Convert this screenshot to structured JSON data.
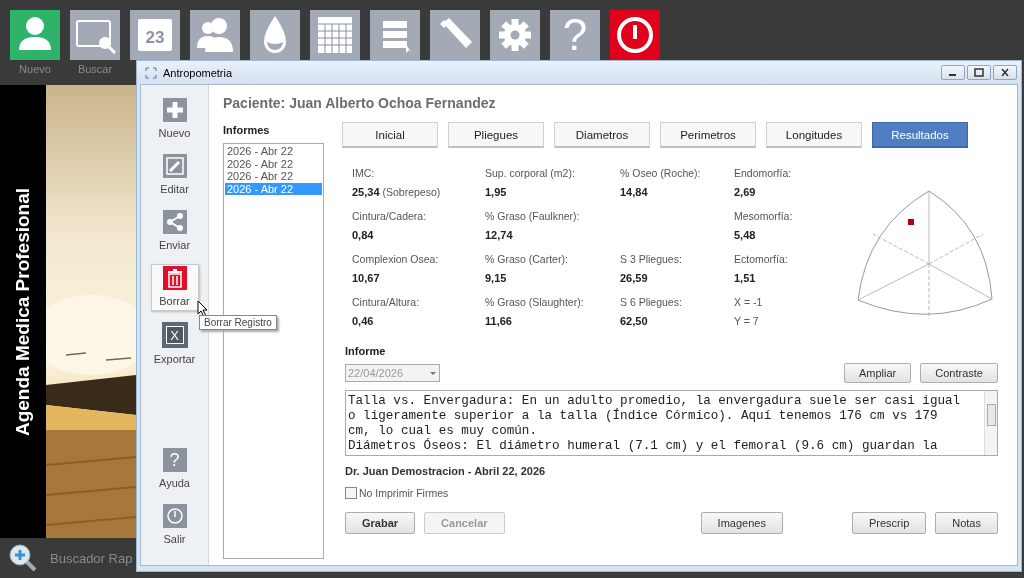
{
  "toolbar": [
    {
      "kind": "person",
      "label": "Nuevo",
      "color": "#2fb36b"
    },
    {
      "kind": "screen-search",
      "label": "Buscar",
      "color": "#a3aab5"
    },
    {
      "kind": "calendar",
      "badge": "23",
      "color": "#a3aab5"
    },
    {
      "kind": "people",
      "color": "#a3aab5"
    },
    {
      "kind": "drop",
      "color": "#a3aab5"
    },
    {
      "kind": "grid",
      "color": "#a3aab5"
    },
    {
      "kind": "list",
      "color": "#a3aab5"
    },
    {
      "kind": "pen",
      "color": "#a3aab5"
    },
    {
      "kind": "gear",
      "color": "#a3aab5"
    },
    {
      "kind": "help",
      "glyph": "?",
      "color": "#a3aab5"
    },
    {
      "kind": "power",
      "color": "#e0001b"
    }
  ],
  "side_title": "Agenda Medica Profesional",
  "quick_search": "Buscador Rap",
  "window": {
    "title": "Antropometria"
  },
  "sidebar": [
    {
      "kind": "plus",
      "label": "Nuevo",
      "hovered": false
    },
    {
      "kind": "edit",
      "label": "Editar",
      "hovered": false
    },
    {
      "kind": "share",
      "label": "Enviar",
      "hovered": false
    },
    {
      "kind": "trash",
      "label": "Borrar",
      "hovered": true,
      "tooltip": "Borrar Registro"
    },
    {
      "kind": "excel",
      "glyph": "X",
      "label": "Exportar",
      "hovered": false
    }
  ],
  "sidebar_bottom": [
    {
      "kind": "help",
      "glyph": "?",
      "label": "Ayuda",
      "hovered": false
    },
    {
      "kind": "power",
      "label": "Salir",
      "hovered": false
    }
  ],
  "patient": "Paciente: Juan Alberto Ochoa Fernandez",
  "reports": {
    "title": "Informes",
    "items": [
      {
        "label": "2026 - Abr 22",
        "selected": false
      },
      {
        "label": "2026 - Abr 22",
        "selected": false
      },
      {
        "label": "2026 - Abr 22",
        "selected": false
      },
      {
        "label": "2026 - Abr 22",
        "selected": true
      }
    ]
  },
  "tabs": [
    {
      "label": "Inicial",
      "selected": false
    },
    {
      "label": "Pliegues",
      "selected": false
    },
    {
      "label": "Diametros",
      "selected": false
    },
    {
      "label": "Perimetros",
      "selected": false
    },
    {
      "label": "Longitudes",
      "selected": false
    },
    {
      "label": "Resultados",
      "selected": true
    }
  ],
  "results": [
    {
      "kind": "measure",
      "label": "IMC:",
      "value": "25,34",
      "note": "(Sobrepeso)"
    },
    {
      "kind": "measure",
      "label": "Sup. corporal (m2):",
      "value": "1,95"
    },
    {
      "kind": "measure",
      "label": "% Oseo (Roche):",
      "value": "14,84"
    },
    {
      "kind": "measure",
      "label": "Endomorfía:",
      "value": "2,69"
    },
    {
      "kind": "measure",
      "label": "Cintura/Cadera:",
      "value": "0,84"
    },
    {
      "kind": "measure",
      "label": "% Graso (Faulkner):",
      "value": "12,74"
    },
    {
      "kind": "blank"
    },
    {
      "kind": "measure",
      "label": "Mesomorfía:",
      "value": "5,48"
    },
    {
      "kind": "measure",
      "label": "Complexion Osea:",
      "value": "10,67"
    },
    {
      "kind": "measure",
      "label": "% Graso (Carter):",
      "value": "9,15"
    },
    {
      "kind": "measure",
      "label": "S 3 Pliegues:",
      "value": "26,59"
    },
    {
      "kind": "measure",
      "label": "Ectomorfía:",
      "value": "1,51"
    },
    {
      "kind": "measure",
      "label": "Cintura/Altura:",
      "value": "0,46"
    },
    {
      "kind": "measure",
      "label": "% Graso (Slaughter):",
      "value": "11,66"
    },
    {
      "kind": "measure",
      "label": "S 6 Pliegues:",
      "value": "62,50"
    },
    {
      "kind": "coords",
      "label": "X = -1",
      "value": "Y = 7"
    }
  ],
  "informe": {
    "title": "Informe",
    "date": "22/04/2026",
    "date_disabled": true,
    "buttons": [
      "Ampliar",
      "Contraste"
    ],
    "lines": [
      "Talla vs. Envergadura: En un adulto promedio, la envergadura suele ser casi igual",
      "o ligeramente superior a la talla (Índice Córmico). Aquí tenemos 176 cm vs 179",
      "cm, lo cual es muy común.",
      "Diámetros Óseos: El diámetro humeral (7.1 cm) y el femoral (9.6 cm) guardan la"
    ],
    "signature": "Dr. Juan Demostracion - Abril 22, 2026",
    "no_print": {
      "label": "No Imprimir Firmes",
      "checked": false
    }
  },
  "form_buttons": [
    {
      "label": "Grabar",
      "disabled": false
    },
    {
      "label": "Cancelar",
      "disabled": true
    }
  ],
  "extra_buttons": [
    {
      "label": "Imagenes",
      "disabled": false
    }
  ],
  "print_buttons": [
    {
      "label": "Prescrip",
      "disabled": false
    },
    {
      "label": "Notas",
      "disabled": false
    }
  ]
}
